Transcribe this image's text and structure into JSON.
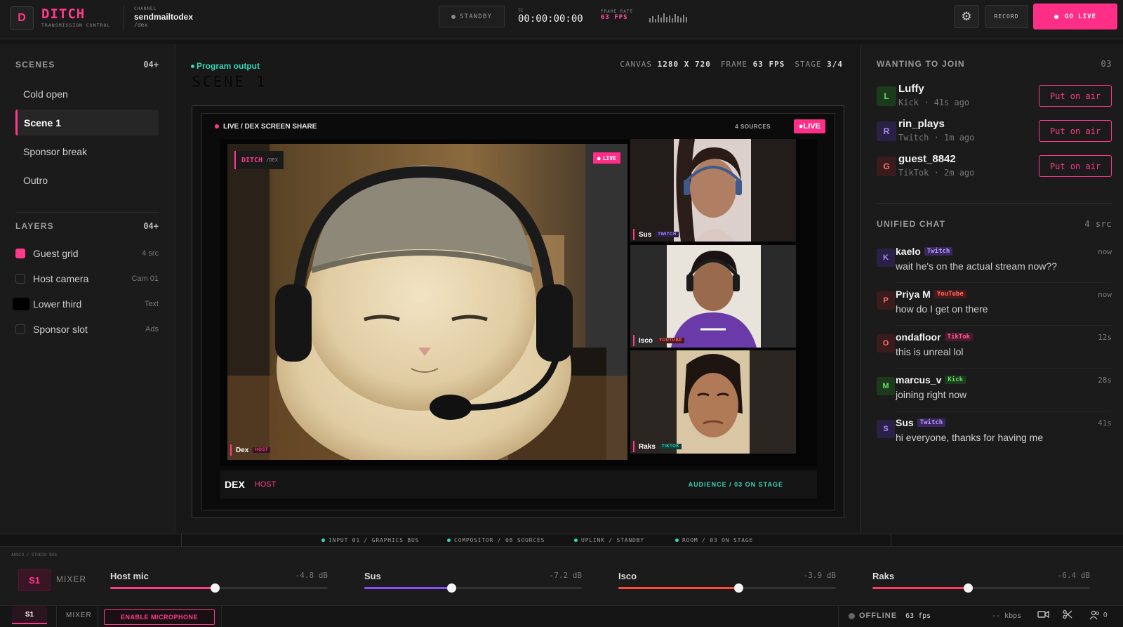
{
  "colors": {
    "accent": "#ff3a8c",
    "teal": "#36d6b6",
    "bg": "#151515"
  },
  "topbar": {
    "logo_glyph": "D",
    "brand_name": "DITCH",
    "brand_sub": "TRANSMISSION CONTROL",
    "channel_label": "CHANNEL",
    "channel_name": "sendmailtodex",
    "channel_path": "/dex",
    "standby_label": "STANDBY",
    "tc_label": "TC",
    "timecode": "00:00:00:00",
    "framerate_label": "FRAME RATE",
    "framerate_value": "63 FPS",
    "settings_icon": "gear-icon",
    "record_label": "RECORD",
    "golive_label": "GO LIVE"
  },
  "scenes": {
    "title": "SCENES",
    "count": "04",
    "add": "+",
    "items": [
      {
        "label": "Cold open",
        "active": false
      },
      {
        "label": "Scene 1",
        "active": true
      },
      {
        "label": "Sponsor break",
        "active": false
      },
      {
        "label": "Outro",
        "active": false
      }
    ]
  },
  "layers": {
    "title": "LAYERS",
    "count": "04",
    "add": "+",
    "items": [
      {
        "label": "Guest grid",
        "meta": "4 src",
        "checked": true
      },
      {
        "label": "Host camera",
        "meta": "Cam 01",
        "checked": false
      },
      {
        "label": "Lower third",
        "meta": "Text",
        "checked": false
      },
      {
        "label": "Sponsor slot",
        "meta": "Ads",
        "checked": false
      }
    ]
  },
  "center": {
    "program_label": "Program output",
    "scene_title": "SCENE 1",
    "canvas_label": "CANVAS",
    "canvas_value": "1280 X 720",
    "frame_label": "FRAME",
    "frame_value": "63 FPS",
    "stage_label": "STAGE",
    "stage_value": "3/4",
    "bar_title": "LIVE / DEX SCREEN SHARE",
    "bar_sources": "4 SOURCES",
    "live_tag": "LIVE",
    "feed_brand": "DITCH",
    "feed_brand_sub": "/DEX",
    "feed_live": "LIVE",
    "host": {
      "name": "Dex",
      "platform": "HOST"
    },
    "guests": [
      {
        "name": "Sus",
        "platform": "TWITCH",
        "color": "#9146ff"
      },
      {
        "name": "Isco",
        "platform": "YOUTUBE",
        "color": "#ff3a3a"
      },
      {
        "name": "Raks",
        "platform": "TIKTOK",
        "color": "#25c2b0"
      }
    ],
    "lower_third_name": "DEX",
    "lower_third_role": "HOST",
    "audience_label": "AUDIENCE / 03 ON STAGE"
  },
  "join": {
    "title": "WANTING TO JOIN",
    "count": "03",
    "button_label": "Put on air",
    "items": [
      {
        "initial": "L",
        "name": "Luffy",
        "meta": "Kick · 41s ago",
        "bg": "#1d3a1d",
        "fg": "#5ee05e"
      },
      {
        "initial": "R",
        "name": "rin_plays",
        "meta": "Twitch · 1m ago",
        "bg": "#2b2147",
        "fg": "#a88cff"
      },
      {
        "initial": "G",
        "name": "guest_8842",
        "meta": "TikTok · 2m ago",
        "bg": "#3a1c1c",
        "fg": "#ff6f6f"
      }
    ]
  },
  "chat": {
    "title": "UNIFIED CHAT",
    "count": "4 src",
    "items": [
      {
        "initial": "K",
        "user": "kaelo",
        "badge": "Twitch",
        "badge_bg": "#3a2860",
        "badge_fg": "#b79cff",
        "time": "now",
        "msg": "wait he's on the actual stream now??",
        "av_bg": "#2b2147",
        "av_fg": "#a88cff"
      },
      {
        "initial": "P",
        "user": "Priya M",
        "badge": "YouTube",
        "badge_bg": "#4a1a1a",
        "badge_fg": "#ff6a6a",
        "time": "now",
        "msg": "how do I get on there",
        "av_bg": "#3a1c1c",
        "av_fg": "#ff6f6f"
      },
      {
        "initial": "O",
        "user": "ondafloor",
        "badge": "TikTok",
        "badge_bg": "#4a1a2c",
        "badge_fg": "#ff5aa0",
        "time": "12s",
        "msg": "this is unreal lol",
        "av_bg": "#3a1c1c",
        "av_fg": "#ff6f6f"
      },
      {
        "initial": "M",
        "user": "marcus_v",
        "badge": "Kick",
        "badge_bg": "#1d3a1d",
        "badge_fg": "#5ee05e",
        "time": "28s",
        "msg": "joining right now",
        "av_bg": "#1d3a1d",
        "av_fg": "#5ee05e"
      },
      {
        "initial": "S",
        "user": "Sus",
        "badge": "Twitch",
        "badge_bg": "#3a2860",
        "badge_fg": "#b79cff",
        "time": "41s",
        "msg": "hi everyone, thanks for having me",
        "av_bg": "#2b2147",
        "av_fg": "#a88cff"
      }
    ]
  },
  "status_strip": {
    "items": [
      "INPUT 01 / GRAPHICS BUS",
      "COMPOSITOR / 08 SOURCES",
      "UPLINK / STANDBY",
      "ROOM / 03 ON STAGE"
    ]
  },
  "mixer": {
    "mini_label": "AUDIO / STUDIO BUS",
    "s1": "S1",
    "label": "MIXER",
    "channels": [
      {
        "name": "Host mic",
        "db": "-4.8 dB",
        "level": 0.48,
        "color": "#ff3a8c"
      },
      {
        "name": "Sus",
        "db": "-7.2 dB",
        "level": 0.4,
        "color": "#8a4dff"
      },
      {
        "name": "Isco",
        "db": "-3.9 dB",
        "level": 0.55,
        "color": "#ff4a3a"
      },
      {
        "name": "Raks",
        "db": "-6.4 dB",
        "level": 0.44,
        "color": "#ff3a5a"
      }
    ]
  },
  "bottombar": {
    "s1": "S1",
    "mixer": "MIXER",
    "enable_mic": "ENABLE MICROPHONE",
    "offline": "OFFLINE",
    "fps": "63 fps",
    "kbps": "-- kbps",
    "viewers": "0"
  }
}
